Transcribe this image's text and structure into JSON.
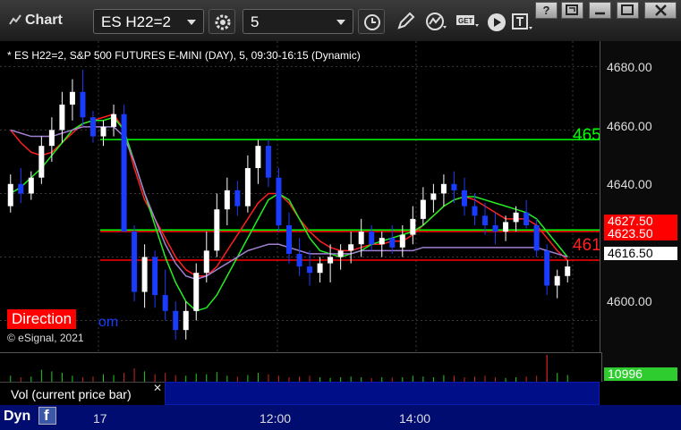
{
  "window": {
    "title": "Chart",
    "symbol": "ES H22=2",
    "interval": "5",
    "controls": [
      "?",
      "restore",
      "maximize",
      "close"
    ]
  },
  "toolbar": {
    "icons": [
      "settings-gear-icon",
      "clock-icon",
      "pencil-icon",
      "study-icon",
      "get-icon",
      "play-icon",
      "text-tool-icon"
    ]
  },
  "chart": {
    "legend": "* ES H22=2, S&P 500 FUTURES E-MINI (DAY), 5, 09:30-16:15 (Dynamic)",
    "copyright": "© eSignal, 2021",
    "direction_label": "Direction",
    "direction_tail": "om",
    "y_ticks": [
      "4680.00",
      "4660.00",
      "4640.00",
      "4600.00"
    ],
    "line_labels": {
      "green": "465",
      "red": "461"
    },
    "price_tags": [
      {
        "text": "4627.50",
        "bg": "#ff0000",
        "fg": "#ffffff"
      },
      {
        "text": "4623.50",
        "bg": "#ff0000",
        "fg": "#ffffff"
      },
      {
        "text": "4616.50",
        "bg": "#ffffff",
        "fg": "#000000"
      }
    ]
  },
  "chart_data": {
    "type": "candlestick",
    "ylim": [
      4590,
      4688
    ],
    "series": [
      {
        "name": "candles",
        "ohlc": [
          [
            4636,
            4646,
            4634,
            4643
          ],
          [
            4643,
            4648,
            4637,
            4640
          ],
          [
            4640,
            4647,
            4638,
            4645
          ],
          [
            4645,
            4658,
            4643,
            4655
          ],
          [
            4655,
            4664,
            4650,
            4660
          ],
          [
            4660,
            4672,
            4656,
            4668
          ],
          [
            4668,
            4676,
            4663,
            4672
          ],
          [
            4672,
            4679,
            4661,
            4664
          ],
          [
            4664,
            4666,
            4656,
            4658
          ],
          [
            4658,
            4663,
            4655,
            4661
          ],
          [
            4661,
            4668,
            4658,
            4665
          ],
          [
            4665,
            4668,
            4628,
            4628
          ],
          [
            4628,
            4630,
            4606,
            4609
          ],
          [
            4609,
            4624,
            4604,
            4620
          ],
          [
            4620,
            4622,
            4604,
            4608
          ],
          [
            4608,
            4616,
            4600,
            4603
          ],
          [
            4603,
            4606,
            4594,
            4597
          ],
          [
            4597,
            4606,
            4594,
            4603
          ],
          [
            4603,
            4618,
            4600,
            4615
          ],
          [
            4615,
            4628,
            4612,
            4622
          ],
          [
            4622,
            4640,
            4620,
            4635
          ],
          [
            4635,
            4645,
            4630,
            4641
          ],
          [
            4641,
            4644,
            4633,
            4636
          ],
          [
            4636,
            4652,
            4634,
            4648
          ],
          [
            4648,
            4657,
            4643,
            4655
          ],
          [
            4655,
            4657,
            4642,
            4645
          ],
          [
            4645,
            4648,
            4628,
            4630
          ],
          [
            4630,
            4634,
            4618,
            4621
          ],
          [
            4621,
            4626,
            4614,
            4617
          ],
          [
            4617,
            4622,
            4611,
            4615
          ],
          [
            4615,
            4620,
            4612,
            4618
          ],
          [
            4618,
            4624,
            4612,
            4620
          ],
          [
            4620,
            4624,
            4616,
            4622
          ],
          [
            4622,
            4628,
            4618,
            4624
          ],
          [
            4624,
            4632,
            4620,
            4628
          ],
          [
            4628,
            4630,
            4622,
            4624
          ],
          [
            4624,
            4628,
            4620,
            4626
          ],
          [
            4626,
            4630,
            4621,
            4623
          ],
          [
            4623,
            4630,
            4620,
            4627
          ],
          [
            4627,
            4636,
            4624,
            4632
          ],
          [
            4632,
            4642,
            4630,
            4638
          ],
          [
            4638,
            4643,
            4634,
            4640
          ],
          [
            4640,
            4646,
            4636,
            4643
          ],
          [
            4643,
            4647,
            4637,
            4641
          ],
          [
            4641,
            4645,
            4633,
            4636
          ],
          [
            4636,
            4640,
            4630,
            4633
          ],
          [
            4633,
            4637,
            4627,
            4630
          ],
          [
            4630,
            4634,
            4624,
            4628
          ],
          [
            4628,
            4633,
            4625,
            4631
          ],
          [
            4631,
            4636,
            4628,
            4634
          ],
          [
            4634,
            4638,
            4629,
            4630
          ],
          [
            4630,
            4632,
            4620,
            4622
          ],
          [
            4622,
            4624,
            4608,
            4611
          ],
          [
            4611,
            4616,
            4607,
            4614
          ],
          [
            4614,
            4619,
            4612,
            4617
          ]
        ]
      },
      {
        "name": "ma-red",
        "values": [
          4660,
          4656,
          4653,
          4652,
          4653,
          4656,
          4659,
          4662,
          4663,
          4664,
          4665,
          4660,
          4648,
          4638,
          4632,
          4626,
          4620,
          4616,
          4614,
          4614,
          4617,
          4622,
          4627,
          4632,
          4637,
          4640,
          4640,
          4637,
          4632,
          4628,
          4625,
          4623,
          4622,
          4622,
          4623,
          4624,
          4624,
          4625,
          4625,
          4627,
          4630,
          4633,
          4636,
          4638,
          4639,
          4638,
          4636,
          4634,
          4632,
          4632,
          4632,
          4630,
          4626,
          4622,
          4619
        ]
      },
      {
        "name": "ma-green",
        "values": [
          4640,
          4642,
          4645,
          4648,
          4652,
          4656,
          4660,
          4662,
          4663,
          4663,
          4664,
          4660,
          4650,
          4640,
          4630,
          4620,
          4612,
          4606,
          4603,
          4604,
          4608,
          4614,
          4620,
          4626,
          4632,
          4638,
          4640,
          4638,
          4632,
          4626,
          4622,
          4621,
          4620,
          4621,
          4622,
          4624,
          4625,
          4626,
          4627,
          4628,
          4630,
          4633,
          4636,
          4638,
          4639,
          4639,
          4638,
          4637,
          4636,
          4635,
          4634,
          4632,
          4628,
          4624,
          4620
        ]
      },
      {
        "name": "ma-purple",
        "values": [
          4660,
          4659,
          4658,
          4658,
          4658,
          4659,
          4660,
          4661,
          4661,
          4661,
          4661,
          4658,
          4650,
          4640,
          4632,
          4624,
          4618,
          4614,
          4613,
          4614,
          4616,
          4618,
          4620,
          4622,
          4623,
          4624,
          4624,
          4623,
          4622,
          4621,
          4621,
          4621,
          4621,
          4621,
          4622,
          4622,
          4622,
          4622,
          4622,
          4622,
          4623,
          4623,
          4623,
          4623,
          4623,
          4623,
          4623,
          4623,
          4623,
          4623,
          4623,
          4623,
          4622,
          4621,
          4620
        ]
      }
    ],
    "horizontal_lines": [
      {
        "value": 4657,
        "color": "#00ff00"
      },
      {
        "value": 4628,
        "color": "#ff0000"
      },
      {
        "value": 4628.5,
        "color": "#00ff00"
      },
      {
        "value": 4619,
        "color": "#ff0000"
      }
    ],
    "volume": [
      40,
      30,
      35,
      80,
      70,
      60,
      40,
      30,
      35,
      50,
      45,
      60,
      90,
      70,
      50,
      60,
      45,
      40,
      55,
      50,
      65,
      40,
      35,
      45,
      60,
      50,
      40,
      30,
      35,
      40,
      30,
      25,
      30,
      35,
      30,
      25,
      30,
      28,
      30,
      40,
      35,
      30,
      45,
      40,
      30,
      35,
      40,
      30,
      25,
      30,
      35,
      40,
      180,
      60,
      45
    ],
    "volume_current": "10996",
    "x_ticks": [
      "17",
      "12:00",
      "14:00"
    ],
    "vol_study_label": "Vol (current price bar)"
  },
  "status": {
    "dyn": "Dyn"
  }
}
